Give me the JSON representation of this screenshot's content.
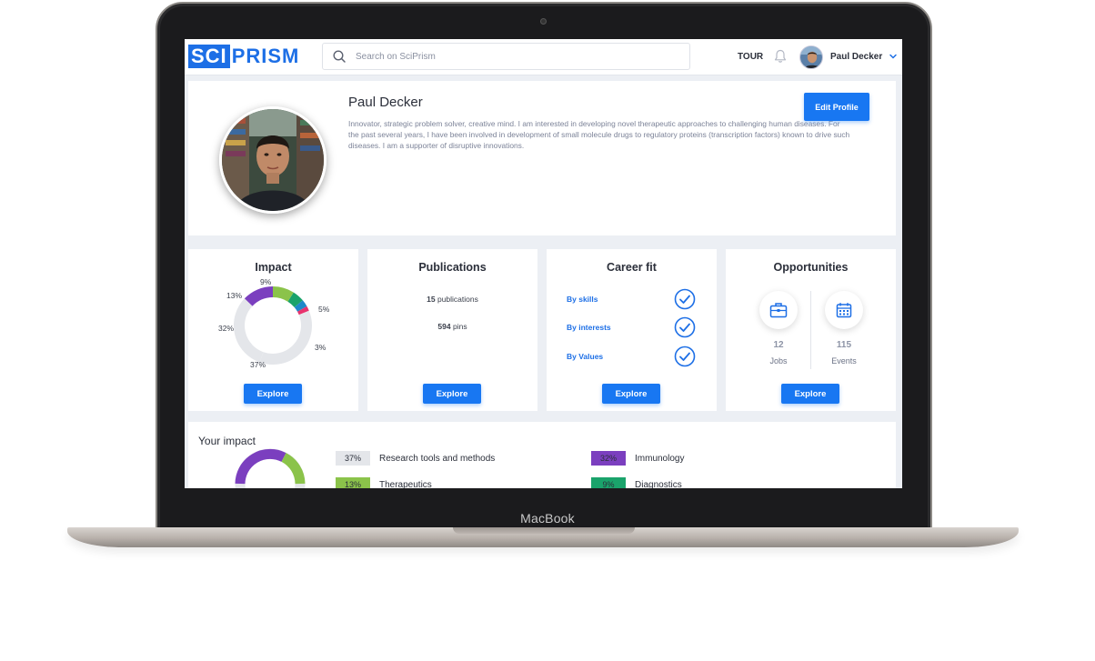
{
  "device": {
    "label": "MacBook"
  },
  "header": {
    "logo_left": "SCI",
    "logo_right": "PRISM",
    "search_placeholder": "Search on SciPrism",
    "tour_label": "TOUR",
    "user_name": "Paul Decker"
  },
  "profile": {
    "name": "Paul Decker",
    "bio": "Innovator, strategic problem solver, creative mind. I am interested in developing novel therapeutic approaches to challenging human diseases. For the past several years, I have been involved in development of small molecule drugs to regulatory proteins (transcription factors) known to drive such diseases. I am a supporter of disruptive innovations.",
    "edit_label": "Edit Profile"
  },
  "cards": {
    "impact": {
      "title": "Impact",
      "button": "Explore",
      "chart_data": {
        "type": "pie",
        "donut": true,
        "slices": [
          {
            "label": "9%",
            "value": 9,
            "color": "#8bc34a"
          },
          {
            "label": "5%",
            "value": 5,
            "color": "#1aa36b"
          },
          {
            "label": "3%",
            "value": 3,
            "color": "#1e88c8"
          },
          {
            "label": "",
            "value": 2,
            "color": "#e8336d"
          },
          {
            "label": "37%",
            "value": 37,
            "color": "#e4e6ea"
          },
          {
            "label": "32%",
            "value": 32,
            "color": "#e4e6ea"
          },
          {
            "label": "13%",
            "value": 13,
            "color": "#7b3fbf"
          }
        ]
      }
    },
    "publications": {
      "title": "Publications",
      "pubs_count": "15",
      "pubs_label": "publications",
      "pins_count": "594",
      "pins_label": "pins",
      "button": "Explore"
    },
    "career_fit": {
      "title": "Career fit",
      "items": [
        {
          "label": "By skills"
        },
        {
          "label": "By interests"
        },
        {
          "label": "By Values"
        }
      ],
      "button": "Explore"
    },
    "opportunities": {
      "title": "Opportunities",
      "jobs_count": "12",
      "jobs_label": "Jobs",
      "events_count": "115",
      "events_label": "Events",
      "icons": [
        "briefcase-icon",
        "calendar-icon"
      ],
      "button": "Explore"
    }
  },
  "your_impact": {
    "title": "Your impact",
    "legend": [
      {
        "pct": "37%",
        "label": "Research tools and methods",
        "color": "#e4e6ea"
      },
      {
        "pct": "32%",
        "label": "Immunology",
        "color": "#7b3fbf"
      },
      {
        "pct": "13%",
        "label": "Therapeutics",
        "color": "#8bc34a"
      },
      {
        "pct": "9%",
        "label": "Diagnostics",
        "color": "#1aa36b"
      }
    ]
  },
  "colors": {
    "accent": "#1877f2",
    "brand": "#1d6fe6",
    "background": "#eceff4"
  }
}
